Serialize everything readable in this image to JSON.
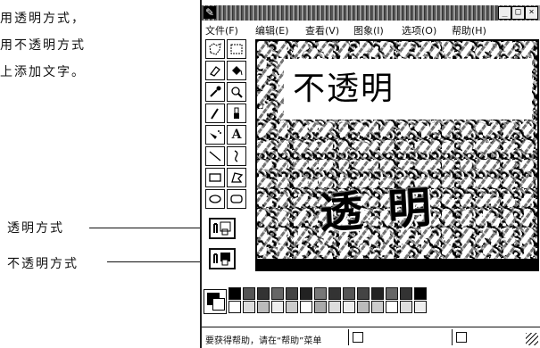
{
  "document": {
    "lines": [
      "用透明方式，",
      "用不透明方式",
      "上添加文字。"
    ],
    "callouts": {
      "transparent": "透明方式",
      "opaque": "不透明方式"
    }
  },
  "window": {
    "title": "",
    "system_icon": "paint-app-icon",
    "controls": {
      "minimize": "_",
      "maximize": "□",
      "close": "×"
    },
    "menu": [
      "文件(F)",
      "编辑(E)",
      "查看(V)",
      "图象(I)",
      "选项(O)",
      "帮助(H)"
    ]
  },
  "toolbox": {
    "tools": [
      "free-form-select-icon",
      "rectangle-select-icon",
      "eraser-icon",
      "fill-bucket-icon",
      "color-picker-icon",
      "magnifier-icon",
      "pencil-icon",
      "brush-icon",
      "airbrush-icon",
      "text-tool-icon",
      "line-icon",
      "curve-icon",
      "rectangle-icon",
      "polygon-icon",
      "ellipse-icon",
      "rounded-rectangle-icon"
    ],
    "text_tool_glyph": "A",
    "modes": [
      {
        "name": "transparent-mode",
        "icon": "transparent-background-icon"
      },
      {
        "name": "opaque-mode",
        "icon": "opaque-background-icon"
      }
    ]
  },
  "canvas": {
    "opaque_text": "不透明",
    "transparent_text": "透 明"
  },
  "palette": {
    "foreground": "#000000",
    "background": "#ffffff",
    "colors_top": [
      "#000000",
      "#555555",
      "#333333",
      "#666666",
      "#444444",
      "#222222",
      "#777777",
      "#333333",
      "#555555",
      "#444444",
      "#222222",
      "#666666",
      "#333333",
      "#000000"
    ],
    "colors_bottom": [
      "#ffffff",
      "#dddddd",
      "#bbbbbb",
      "#eeeeee",
      "#cccccc",
      "#ffffff",
      "#aaaaaa",
      "#dddddd",
      "#eeeeee",
      "#bbbbbb",
      "#cccccc",
      "#ffffff",
      "#dddddd",
      "#eeeeee"
    ]
  },
  "status": {
    "help_text": "要获得帮助，请在“帮助”菜单"
  }
}
